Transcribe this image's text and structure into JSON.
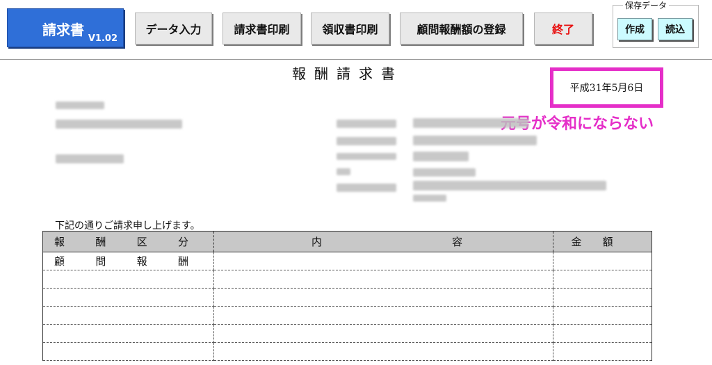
{
  "toolbar": {
    "main_button": {
      "title": "請求書",
      "version": "V1.02",
      "color": "#2f6fd8"
    },
    "buttons": [
      {
        "label": "データ入力"
      },
      {
        "label": "請求書印刷"
      },
      {
        "label": "領収書印刷"
      },
      {
        "label": "顧問報酬額の登録"
      },
      {
        "label": "終了",
        "color": "#e81010"
      }
    ],
    "save_group": {
      "caption": "保存データ",
      "buttons": [
        {
          "label": "作成"
        },
        {
          "label": "読込"
        }
      ]
    }
  },
  "document": {
    "title": "報酬請求書",
    "date": "平成31年5月6日",
    "annotation": {
      "text": "元号が令和にならない",
      "color": "#e52ec8"
    },
    "intro": "下記の通りご請求申し上げます。",
    "table": {
      "headers": [
        "報酬区分",
        [
          "内",
          "容"
        ],
        "金額"
      ],
      "rows": [
        "顧問報酬",
        "",
        "",
        "",
        "",
        ""
      ]
    }
  }
}
